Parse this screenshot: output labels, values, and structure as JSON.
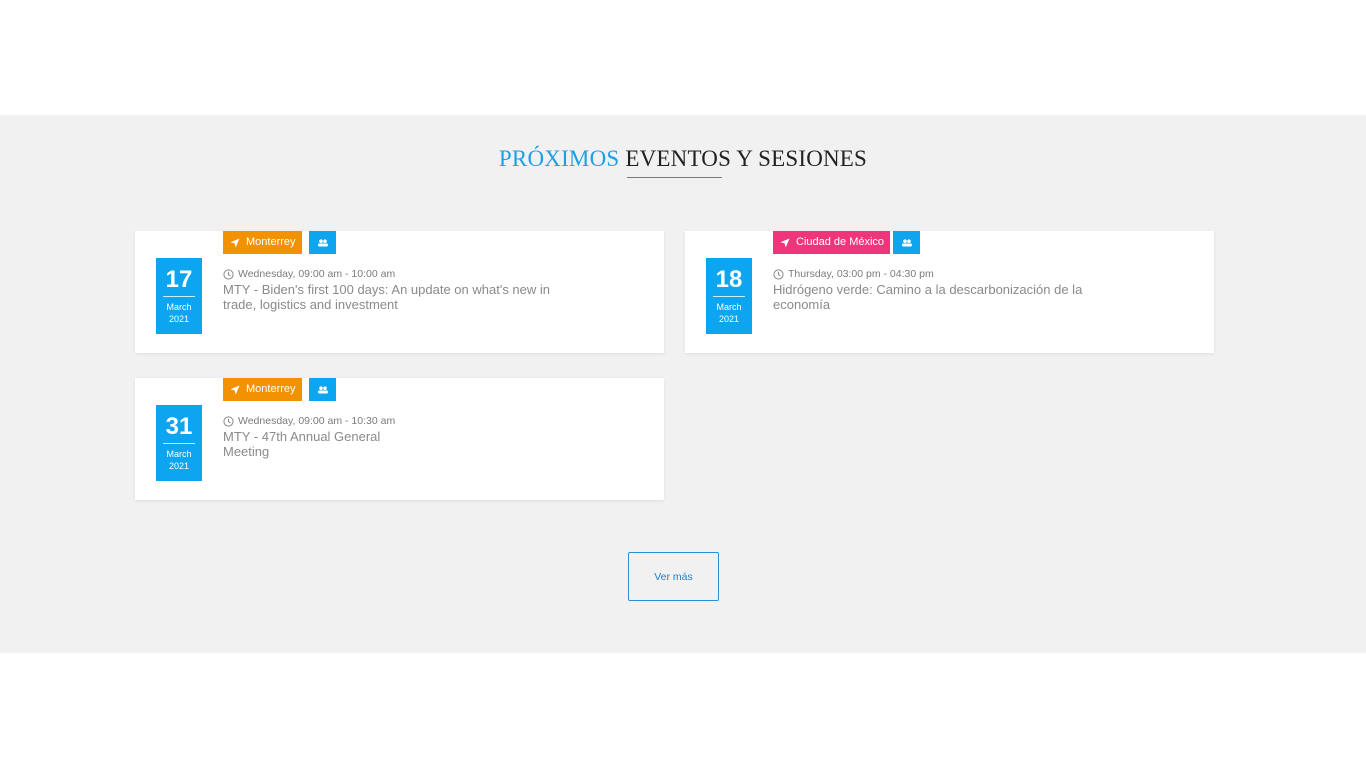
{
  "section": {
    "title_accent": "PRÓXIMOS",
    "title_rest": " EVENTOS Y SESIONES"
  },
  "events": [
    {
      "day": "17",
      "month": "March",
      "year": "2021",
      "location": "Monterrey",
      "location_color": "#f39200",
      "time": "Wednesday, 09:00 am - 10:00 am",
      "title": "MTY - Biden's first 100 days: An update on what's new in trade, logistics and investment"
    },
    {
      "day": "18",
      "month": "March",
      "year": "2021",
      "location": "Ciudad de México",
      "location_color": "#f0357c",
      "time": "Thursday, 03:00 pm - 04:30 pm",
      "title": "Hidrógeno verde: Camino a la descarbonización de la economía"
    },
    {
      "day": "31",
      "month": "March",
      "year": "2021",
      "location": "Monterrey",
      "location_color": "#f39200",
      "time": "Wednesday, 09:00 am - 10:30 am",
      "title": "MTY - 47th Annual General Meeting"
    }
  ],
  "icons": {
    "location": "location-arrow-icon",
    "type": "group-icon",
    "time": "clock-icon"
  },
  "colors": {
    "accent": "#1fa0e3",
    "date_box": "#0ea5f0",
    "button_border": "#2a8fd6"
  },
  "more_button_label": "Ver más"
}
